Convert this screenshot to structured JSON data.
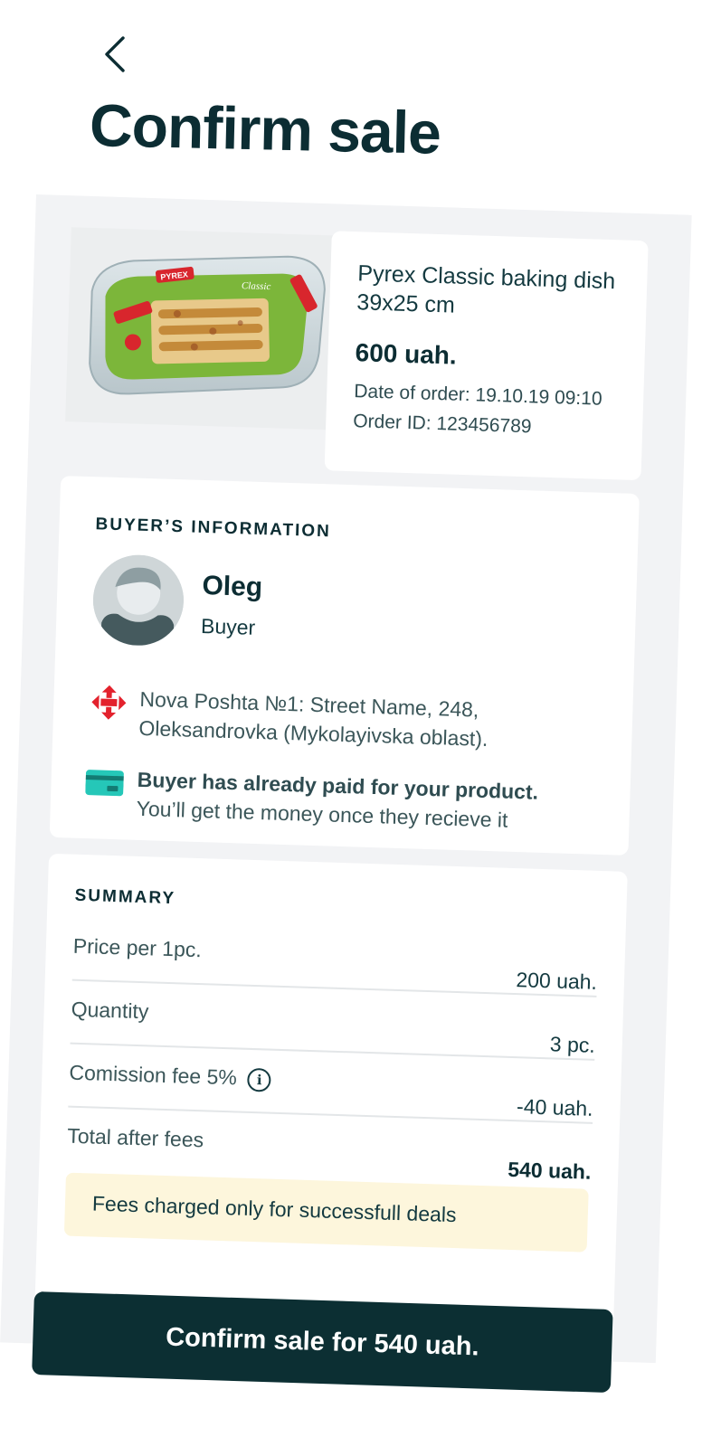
{
  "header": {
    "back_icon": "chevron-left-icon",
    "title": "Confirm sale"
  },
  "product": {
    "name": "Pyrex Classic baking dish 39x25 cm",
    "price": "600 uah.",
    "date_of_order": "Date of order: 19.10.19 09:10",
    "order_id": "Order ID: 123456789",
    "image_brand": "PYREX",
    "image_label": "Classic"
  },
  "buyer": {
    "section_title": "BUYER’S INFORMATION",
    "name": "Oleg",
    "role": "Buyer",
    "delivery_icon": "nova-poshta-icon",
    "address": "Nova Poshta №1: Street Name, 248, Oleksandrovka (Mykolayivska oblast).",
    "payment_icon": "credit-card-icon",
    "paid_title": "Buyer has already paid for your product.",
    "paid_subtitle": "You’ll get the money once they recieve it"
  },
  "summary": {
    "section_title": "SUMMARY",
    "rows": [
      {
        "label": "Price per 1pc.",
        "value": "200 uah."
      },
      {
        "label": "Quantity",
        "value": "3 pc."
      },
      {
        "label": "Comission fee 5%",
        "value": "-40 uah."
      },
      {
        "label": "Total after fees",
        "value": "540 uah."
      }
    ],
    "info_icon": "info-icon",
    "note": "Fees charged only for successfull deals"
  },
  "footer": {
    "confirm_label": "Confirm sale for 540 uah."
  },
  "colors": {
    "primary_dark": "#0c2f33",
    "panel_bg": "#f2f3f5",
    "note_bg": "#fdf6dc",
    "nova_poshta_red": "#e3222d",
    "card_icon_teal": "#25c7b8"
  }
}
